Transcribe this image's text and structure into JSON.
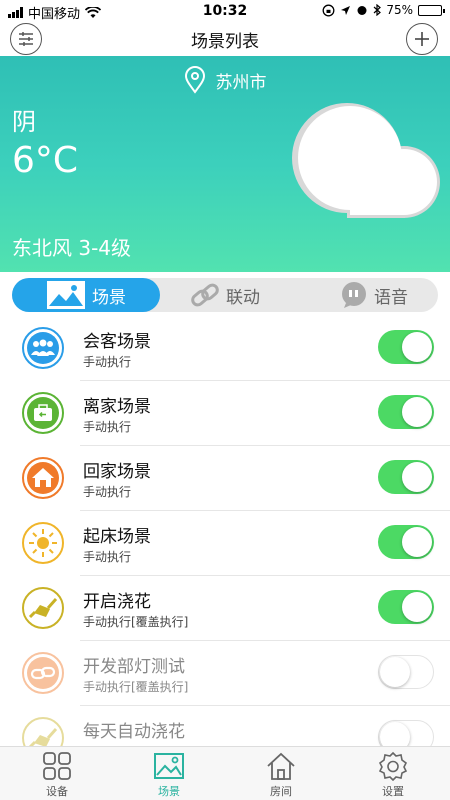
{
  "status_bar": {
    "carrier": "中国移动",
    "time": "10:32",
    "battery": "75%",
    "battery_level": 0.75
  },
  "header": {
    "title": "场景列表"
  },
  "weather": {
    "city": "苏州市",
    "condition": "阴",
    "temperature": "6°C",
    "wind": "东北风 3-4级"
  },
  "tabs": [
    {
      "label": "场景"
    },
    {
      "label": "联动"
    },
    {
      "label": "语音"
    }
  ],
  "scenes": [
    {
      "name": "会客场景",
      "mode": "手动执行",
      "enabled": true,
      "icon": "people-icon",
      "color": "#2a9de8"
    },
    {
      "name": "离家场景",
      "mode": "手动执行",
      "enabled": true,
      "icon": "briefcase-icon",
      "color": "#5bb435"
    },
    {
      "name": "回家场景",
      "mode": "手动执行",
      "enabled": true,
      "icon": "home-icon",
      "color": "#f07a2a"
    },
    {
      "name": "起床场景",
      "mode": "手动执行",
      "enabled": true,
      "icon": "sun-icon",
      "color": "#f0b52a"
    },
    {
      "name": "开启浇花",
      "mode": "手动执行[覆盖执行]",
      "enabled": true,
      "icon": "watering-can-icon",
      "color": "#c9b226"
    },
    {
      "name": "开发部灯测试",
      "mode": "手动执行[覆盖执行]",
      "enabled": false,
      "icon": "link-icon",
      "color": "#f07a2a"
    },
    {
      "name": "每天自动浇花",
      "mode": "",
      "enabled": false,
      "icon": "watering-can-icon",
      "color": "#c9b226"
    }
  ],
  "bottom_nav": [
    {
      "label": "设备",
      "icon": "grid-icon"
    },
    {
      "label": "场景",
      "icon": "picture-icon",
      "active": true
    },
    {
      "label": "房间",
      "icon": "house-icon"
    },
    {
      "label": "设置",
      "icon": "gear-icon"
    }
  ]
}
